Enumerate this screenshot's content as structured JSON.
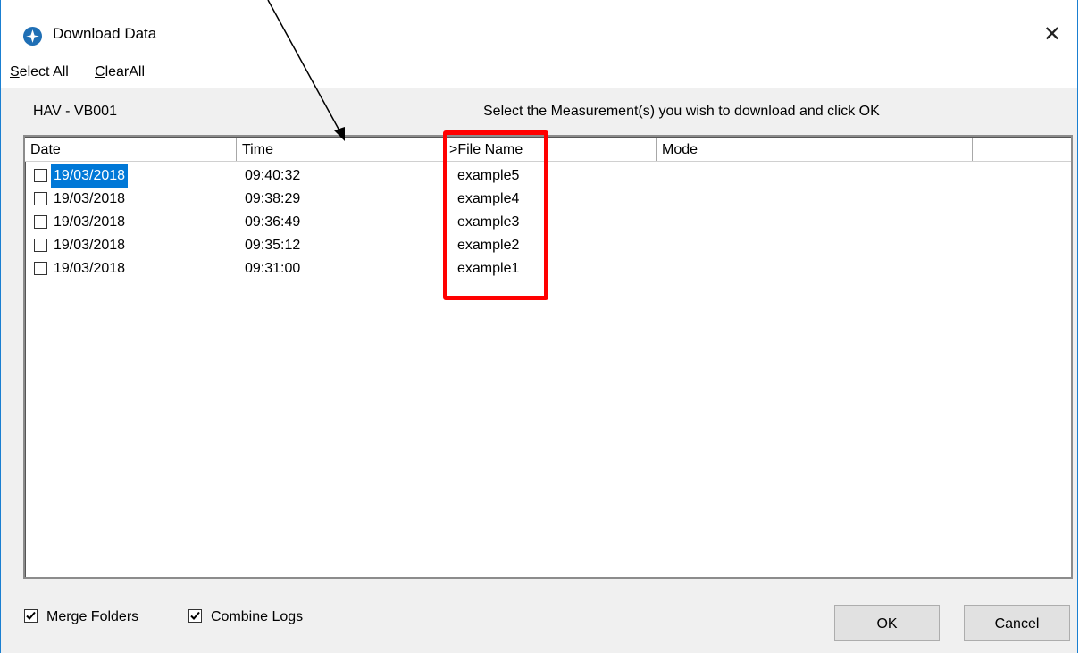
{
  "window": {
    "title": "Download Data",
    "close_glyph": "✕"
  },
  "menu": {
    "select_all": "Select All",
    "clear_all": "ClearAll"
  },
  "device": "HAV - VB001",
  "instruction": "Select the Measurement(s) you wish to download and click OK",
  "columns": [
    "Date",
    "Time",
    ">File Name",
    "Mode"
  ],
  "rows": [
    {
      "date": "19/03/2018",
      "time": "09:40:32",
      "file": "example5",
      "mode": "",
      "checked": false,
      "selected": true
    },
    {
      "date": "19/03/2018",
      "time": "09:38:29",
      "file": "example4",
      "mode": "",
      "checked": false,
      "selected": false
    },
    {
      "date": "19/03/2018",
      "time": "09:36:49",
      "file": "example3",
      "mode": "",
      "checked": false,
      "selected": false
    },
    {
      "date": "19/03/2018",
      "time": "09:35:12",
      "file": "example2",
      "mode": "",
      "checked": false,
      "selected": false
    },
    {
      "date": "19/03/2018",
      "time": "09:31:00",
      "file": "example1",
      "mode": "",
      "checked": false,
      "selected": false
    }
  ],
  "options": {
    "merge_folders": {
      "label": "Merge Folders",
      "checked": true
    },
    "combine_logs": {
      "label": "Combine Logs",
      "checked": true
    }
  },
  "buttons": {
    "ok": "OK",
    "cancel": "Cancel"
  },
  "annotation": {
    "highlight_color": "#ff0000",
    "arrow_color": "#000000"
  },
  "colors": {
    "selection": "#0078d7",
    "window_border": "#1a7fd1"
  }
}
